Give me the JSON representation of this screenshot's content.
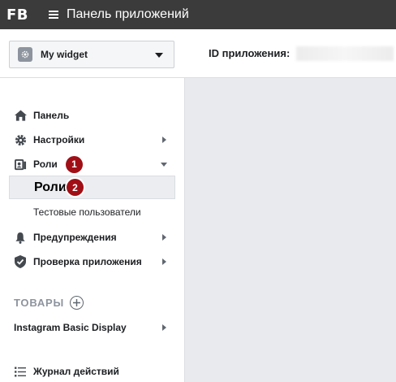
{
  "topbar": {
    "logo": "FB",
    "title": "Панель приложений"
  },
  "header": {
    "app_name": "My widget",
    "app_id_label": "ID приложения:"
  },
  "sidebar": {
    "items": [
      {
        "label": "Панель"
      },
      {
        "label": "Настройки"
      },
      {
        "label": "Роли",
        "badge": "1"
      },
      {
        "label": "Роли",
        "badge": "2"
      },
      {
        "label": "Тестовые пользователи"
      },
      {
        "label": "Предупреждения"
      },
      {
        "label": "Проверка приложения"
      }
    ],
    "products_header": "ТОВАРЫ",
    "products": [
      {
        "label": "Instagram Basic Display"
      }
    ],
    "activity_log": "Журнал действий"
  },
  "icons": [
    "menu-icon",
    "gear-icon",
    "home-icon",
    "settings-icon",
    "roles-icon",
    "bell-icon",
    "shield-icon",
    "add-icon",
    "list-icon"
  ],
  "colors": {
    "topbar": "#3b3b3b",
    "badge": "#a10f16",
    "selected_bg": "#ebedf0"
  }
}
